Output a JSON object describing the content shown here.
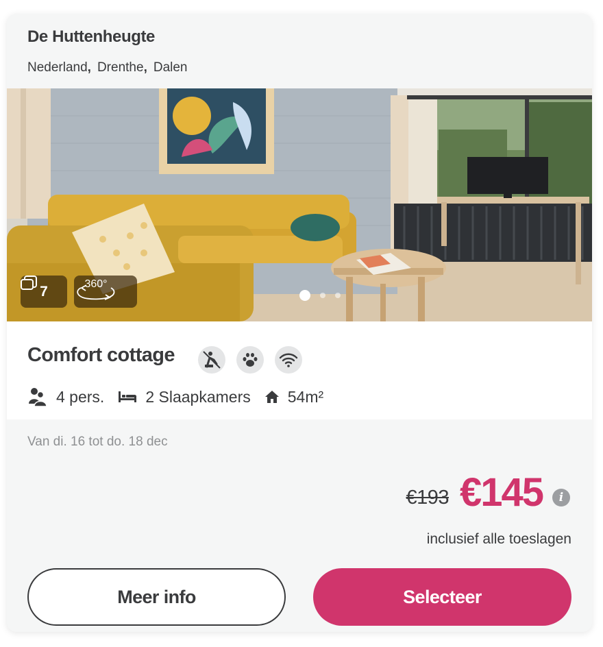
{
  "park": {
    "name": "De Huttenheugte",
    "location": [
      "Nederland",
      "Drenthe",
      "Dalen"
    ],
    "location_separator": ","
  },
  "gallery": {
    "photo_count": "7",
    "tour_label": "360°",
    "slides_total": 3,
    "active_slide": 1,
    "photo_icon": "photo-stack-icon",
    "tour_icon": "rotate-360-icon"
  },
  "accommodation": {
    "name": "Comfort cottage",
    "features": [
      {
        "icon": "no-smoking-icon"
      },
      {
        "icon": "pet-paw-icon"
      },
      {
        "icon": "wifi-icon"
      }
    ],
    "specs": {
      "persons": "4 pers.",
      "bedrooms": "2 Slaapkamers",
      "area": "54m²"
    }
  },
  "booking": {
    "dates": "Van di. 16 tot do. 18 dec",
    "old_price": "€193",
    "price": "€145",
    "price_note": "inclusief alle toeslagen",
    "more_info_label": "Meer info",
    "select_label": "Selecteer"
  },
  "colors": {
    "accent": "#d0356c",
    "text": "#3a3b3d",
    "muted": "#8e9092",
    "panel": "#f5f6f6"
  }
}
